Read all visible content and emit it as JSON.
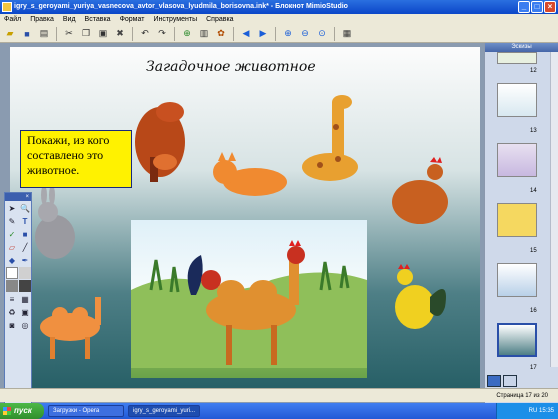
{
  "window": {
    "title": "igry_s_geroyami_yuriya_vasnecova_avtor_vlasova_lyudmila_borisovna.ink* - Блокнот MimioStudio"
  },
  "menu": [
    "Файл",
    "Правка",
    "Вид",
    "Вставка",
    "Формат",
    "Инструменты",
    "Справка"
  ],
  "slide": {
    "title": "Загадочное животное",
    "callout": "Покажи, из кого составлено это животное."
  },
  "panel": {
    "header": "Эскизы",
    "thumbs": [
      "12",
      "13",
      "14",
      "15",
      "16",
      "17"
    ]
  },
  "status": {
    "page": "Страница 17 из 20"
  },
  "taskbar": {
    "start": "пуск",
    "tasks": [
      "Загрузки - Opera",
      "igry_s_geroyami_yuri..."
    ],
    "lang": "RU",
    "clock": "15:35"
  }
}
